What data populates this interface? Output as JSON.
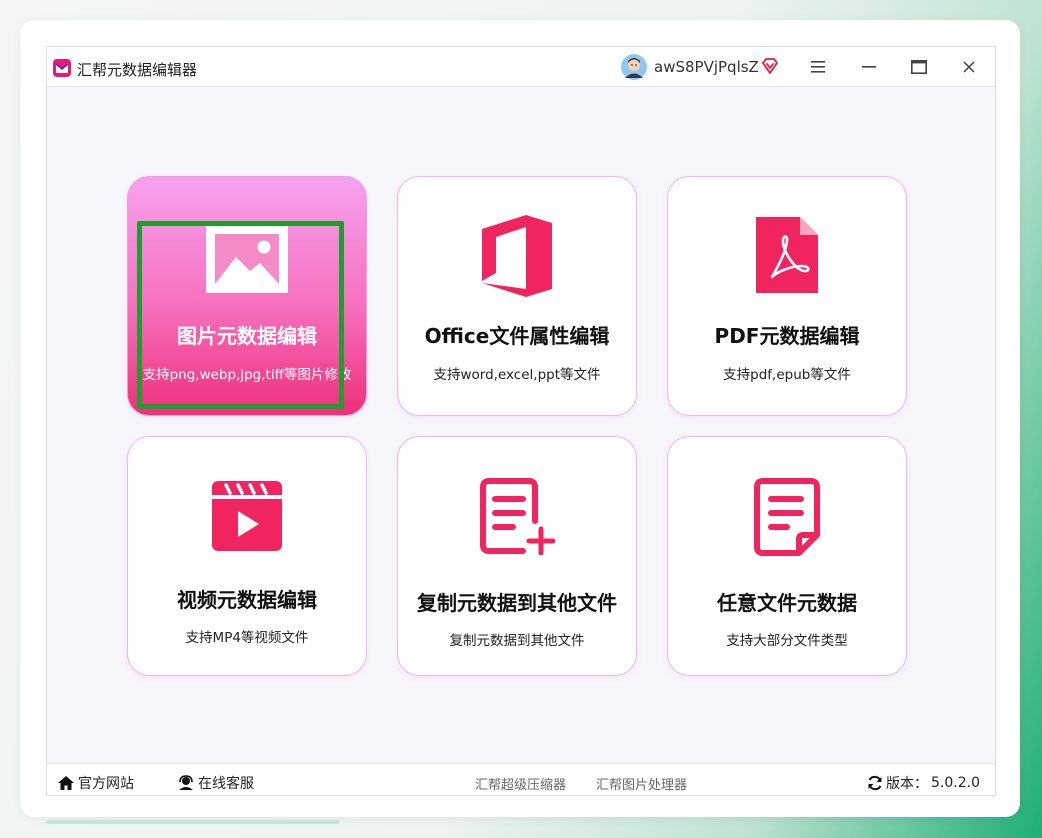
{
  "window": {
    "title": "汇帮元数据编辑器",
    "username": "awS8PVjPqlsZ"
  },
  "icons": {
    "logo": "app-logo-icon",
    "avatar": "user-avatar-icon",
    "vip": "vip-diamond-icon",
    "menu": "hamburger-menu-icon",
    "minimize": "minimize-icon",
    "maximize": "maximize-icon",
    "close": "close-icon"
  },
  "colors": {
    "accent": "#f0245f",
    "card_border": "#f1b4ee",
    "active_gradient_top": "#f6a2f0",
    "active_gradient_bottom": "#ef2f7a",
    "highlight": "#1e9e2d"
  },
  "cards": [
    {
      "title": "图片元数据编辑",
      "subtitle": "支持png,webp,jpg,tiff等图片修改",
      "icon": "image-icon",
      "active": true
    },
    {
      "title": "Office文件属性编辑",
      "subtitle": "支持word,excel,ppt等文件",
      "icon": "office-icon",
      "active": false
    },
    {
      "title": "PDF元数据编辑",
      "subtitle": "支持pdf,epub等文件",
      "icon": "pdf-icon",
      "active": false
    },
    {
      "title": "视频元数据编辑",
      "subtitle": "支持MP4等视频文件",
      "icon": "video-icon",
      "active": false
    },
    {
      "title": "复制元数据到其他文件",
      "subtitle": "复制元数据到其他文件",
      "icon": "copy-doc-icon",
      "active": false
    },
    {
      "title": "任意文件元数据",
      "subtitle": "支持大部分文件类型",
      "icon": "any-file-icon",
      "active": false
    }
  ],
  "footer": {
    "website": "官方网站",
    "support": "在线客服",
    "link1": "汇帮超级压缩器",
    "link2": "汇帮图片处理器",
    "version_label": "版本：",
    "version": "5.0.2.0"
  }
}
